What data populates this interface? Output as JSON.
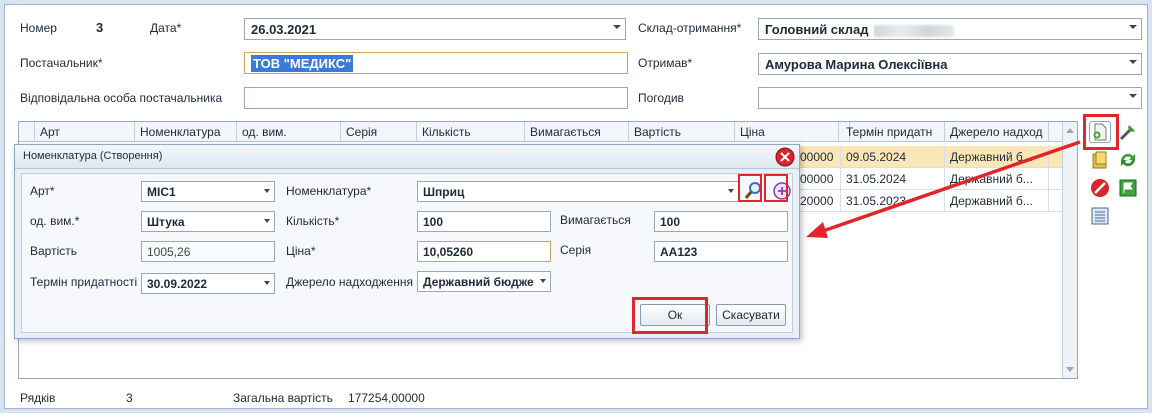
{
  "header": {
    "number_label": "Номер",
    "number_value": "3",
    "date_label": "Дата*",
    "date_value": "26.03.2021",
    "warehouse_label": "Склад-отримання*",
    "warehouse_value": "Головний склад",
    "supplier_label": "Постачальник*",
    "supplier_value": "ТОВ \"МЕДИКС\"",
    "received_label": "Отримав*",
    "received_value": "Амурова Марина Олексіївна",
    "responsible_label": "Відповідальна особа постачальника",
    "responsible_value": "",
    "agreed_label": "Погодив",
    "agreed_value": ""
  },
  "grid": {
    "columns": [
      "Арт",
      "Номенклатура",
      "од. вим.",
      "Серія",
      "Кількість",
      "Вимагається",
      "Вартість",
      "Ціна",
      "",
      "Термін придатн",
      "Джерело надход"
    ],
    "rows": [
      {
        "price_tail": "00000",
        "expiry": "09.05.2024",
        "source": "Державний б..."
      },
      {
        "price_tail": "00000",
        "expiry": "31.05.2024",
        "source": "Державний б..."
      },
      {
        "price_tail": "20000",
        "expiry": "31.05.2023",
        "source": "Державний б..."
      }
    ]
  },
  "dialog": {
    "title": "Номенклатура (Створення)",
    "art_label": "Арт*",
    "art_value": "МІС1",
    "nomenclature_label": "Номенклатура*",
    "nomenclature_value": "Шприц",
    "unit_label": "од. вим.*",
    "unit_value": "Штука",
    "quantity_label": "Кількість*",
    "quantity_value": "100",
    "required_label": "Вимагається",
    "required_value": "100",
    "cost_label": "Вартість",
    "cost_value": "1005,26",
    "price_label": "Ціна*",
    "price_value": "10,05260",
    "series_label": "Серія",
    "series_value": "АА123",
    "expiry_label": "Термін придатності",
    "expiry_value": "30.09.2022",
    "source_label": "Джерело надходження",
    "source_value": "Державний бюдже",
    "ok_label": "Ок",
    "cancel_label": "Скасувати"
  },
  "footer": {
    "rows_label": "Рядків",
    "rows_value": "3",
    "total_label": "Загальна вартість",
    "total_value": "177254,00000"
  },
  "colors": {
    "highlight": "#e0262b",
    "selected_row": "#fbe7b6",
    "selection": "#3b7bd8"
  }
}
